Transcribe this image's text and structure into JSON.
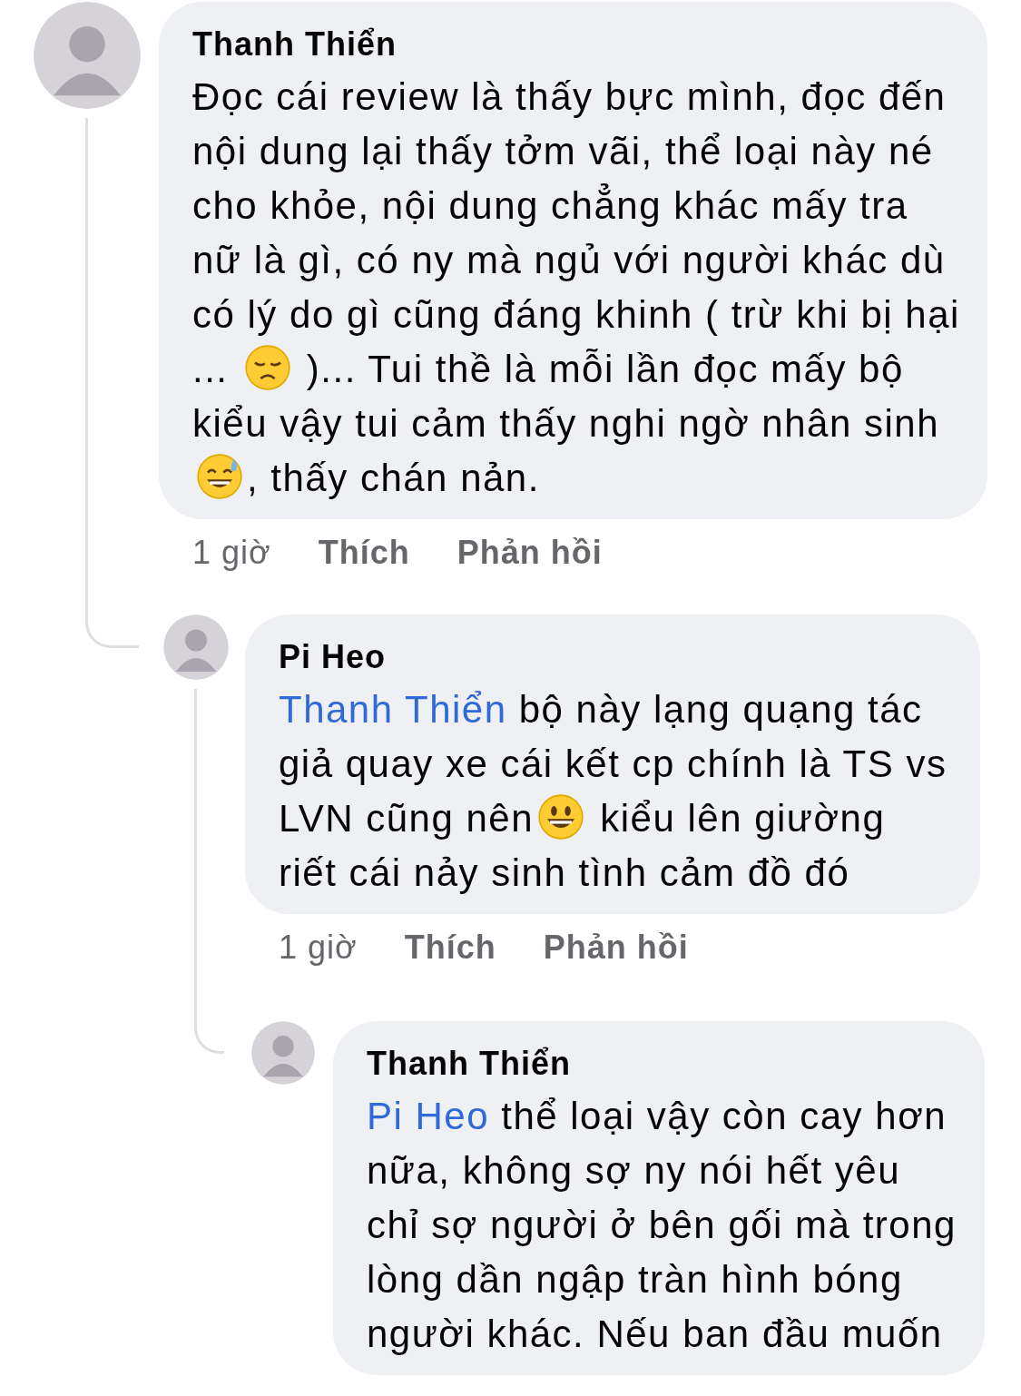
{
  "comments": [
    {
      "author": "Thanh Thiển",
      "body": [
        {
          "kind": "text",
          "text": "Đọc cái review là thấy bực mình, đọc đến nội dung lại thấy tởm vãi, thể loại này né cho khỏe, nội dung chẳng khác mấy tra nữ là gì, có ny mà ngủ với người khác dù có lý do gì cũng đáng khinh ( trừ khi bị hại ... "
        },
        {
          "kind": "emoji-sad"
        },
        {
          "kind": "text",
          "text": " )... Tui thề là mỗi lần đọc mấy bộ kiểu vậy tui cảm thấy nghi ngờ nhân sinh "
        },
        {
          "kind": "emoji-sweat"
        },
        {
          "kind": "text",
          "text": ", thấy chán nản."
        }
      ],
      "time": "1 giờ",
      "actions": [
        "Thích",
        "Phản hồi"
      ],
      "replies": [
        {
          "author": "Pi Heo",
          "body": [
            {
              "kind": "mention",
              "text": "Thanh Thiển"
            },
            {
              "kind": "text",
              "text": " bộ này lạng quạng tác giả quay xe cái kết cp chính là TS vs LVN cũng nên"
            },
            {
              "kind": "emoji-smile"
            },
            {
              "kind": "text",
              "text": " kiểu lên giường riết cái nảy sinh tình cảm đồ đó"
            }
          ],
          "time": "1 giờ",
          "actions": [
            "Thích",
            "Phản hồi"
          ],
          "replies": [
            {
              "author": "Thanh Thiển",
              "body": [
                {
                  "kind": "mention",
                  "text": "Pi Heo"
                },
                {
                  "kind": "text",
                  "text": " thể loại vậy còn cay hơn nữa, không sợ ny nói hết yêu chỉ sợ người ở bên gối mà trong lòng dần ngập tràn hình bóng người khác. Nếu ban đầu muốn"
                }
              ]
            }
          ]
        }
      ]
    }
  ]
}
